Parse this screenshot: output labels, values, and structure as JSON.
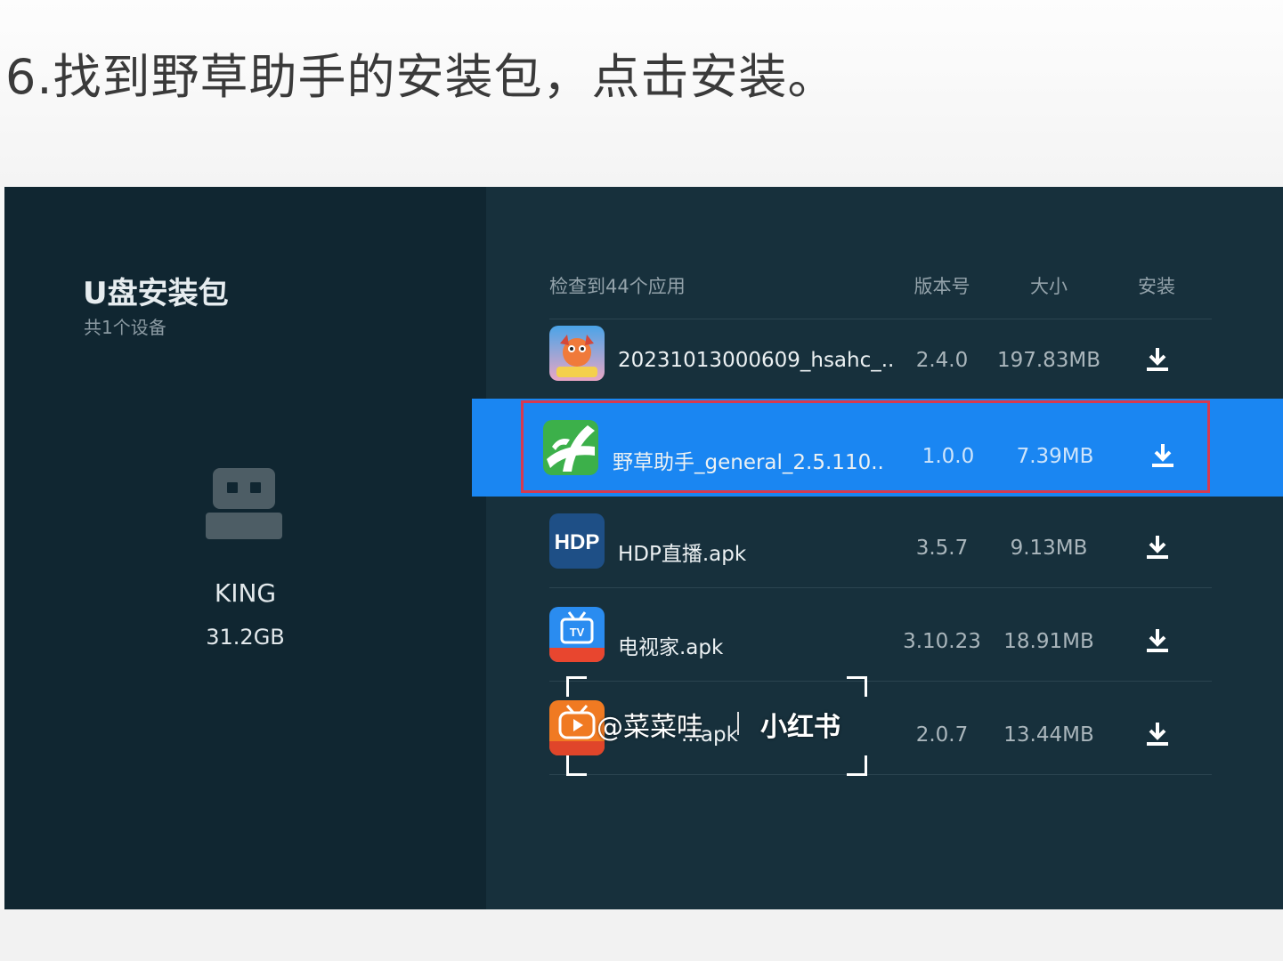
{
  "caption": "6.找到野草助手的安装包，点击安装。",
  "sidebar": {
    "title": "U盘安装包",
    "subtitle": "共1个设备",
    "device": {
      "name": "KING",
      "size": "31.2GB",
      "icon": "usb-drive-icon"
    }
  },
  "table": {
    "headers": {
      "count": "检查到44个应用",
      "version": "版本号",
      "size": "大小",
      "install": "安装"
    },
    "rows": [
      {
        "name": "20231013000609_hsahc_..",
        "version": "2.4.0",
        "size": "197.83MB",
        "icon": "game-app-icon"
      },
      {
        "name": "野草助手_general_2.5.110..",
        "version": "1.0.0",
        "size": "7.39MB",
        "icon": "yecao-app-icon",
        "selected": true
      },
      {
        "name": "HDP直播.apk",
        "version": "3.5.7",
        "size": "9.13MB",
        "icon": "hdp-app-icon",
        "icon_text": "HDP"
      },
      {
        "name": "电视家.apk",
        "version": "3.10.23",
        "size": "18.91MB",
        "icon": "dianshijia-app-icon",
        "icon_text": "TV"
      },
      {
        "name": "...apk",
        "version": "2.0.7",
        "size": "13.44MB",
        "icon": "video-app-icon"
      }
    ]
  },
  "watermark": {
    "text": "@菜菜哇",
    "brand": "小红书"
  },
  "colors": {
    "background": "#17303c",
    "sidebar": "#102631",
    "selected_row": "#1a86f2",
    "highlight_frame": "#d73a4f"
  }
}
